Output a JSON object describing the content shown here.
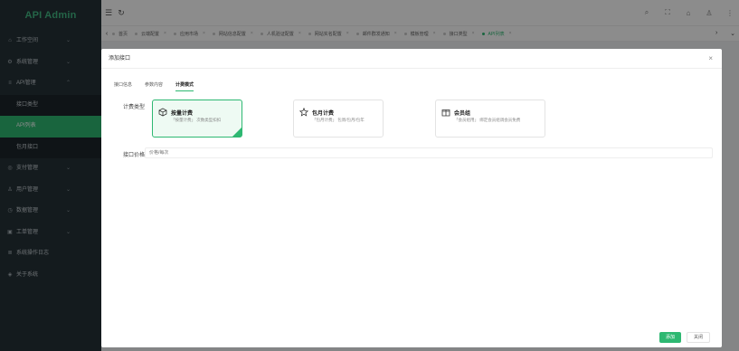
{
  "app": {
    "title": "API Admin"
  },
  "sidebar": {
    "items": [
      {
        "label": "工作空间",
        "icon": "home-icon"
      },
      {
        "label": "系统管理",
        "icon": "gear-icon"
      },
      {
        "label": "API管理",
        "icon": "api-icon"
      },
      {
        "label": "支付管理",
        "icon": "pay-icon"
      },
      {
        "label": "用户管理",
        "icon": "user-icon"
      },
      {
        "label": "数据管理",
        "icon": "data-icon"
      },
      {
        "label": "工单管理",
        "icon": "ticket-icon"
      },
      {
        "label": "系统操作日志",
        "icon": "log-icon"
      },
      {
        "label": "关于系统",
        "icon": "info-icon"
      }
    ],
    "sub_items": [
      {
        "label": "接口类型"
      },
      {
        "label": "API列表"
      },
      {
        "label": "包月接口"
      }
    ]
  },
  "tabs": [
    {
      "label": "首页"
    },
    {
      "label": "云端配置"
    },
    {
      "label": "应用市场"
    },
    {
      "label": "网站信息配置"
    },
    {
      "label": "人机验证配置"
    },
    {
      "label": "网站实名配置"
    },
    {
      "label": "邮件群发通知"
    },
    {
      "label": "模板管理"
    },
    {
      "label": "接口类型"
    },
    {
      "label": "API列表"
    }
  ],
  "dialog": {
    "title": "添加接口",
    "tabs": [
      "接口信息",
      "参数内容",
      "计费模式"
    ],
    "active_tab": "计费模式",
    "billing_type_label": "计费类型",
    "cards": [
      {
        "title": "按量计费",
        "desc": "「按量计费」 次数类型扣扣",
        "selected": true
      },
      {
        "title": "包月计费",
        "desc": "「包月计费」 包周/包月/包年",
        "selected": false
      },
      {
        "title": "会员组",
        "desc": "「会员组用」 绑定会员组调会员免费",
        "selected": false
      }
    ],
    "price_label": "接口价格",
    "price_placeholder": "价格/每次",
    "add_button": "添加",
    "close_button": "关闭"
  },
  "colors": {
    "accent": "#2eb872",
    "sidebar_bg": "#263238",
    "brand": "#42b983"
  }
}
